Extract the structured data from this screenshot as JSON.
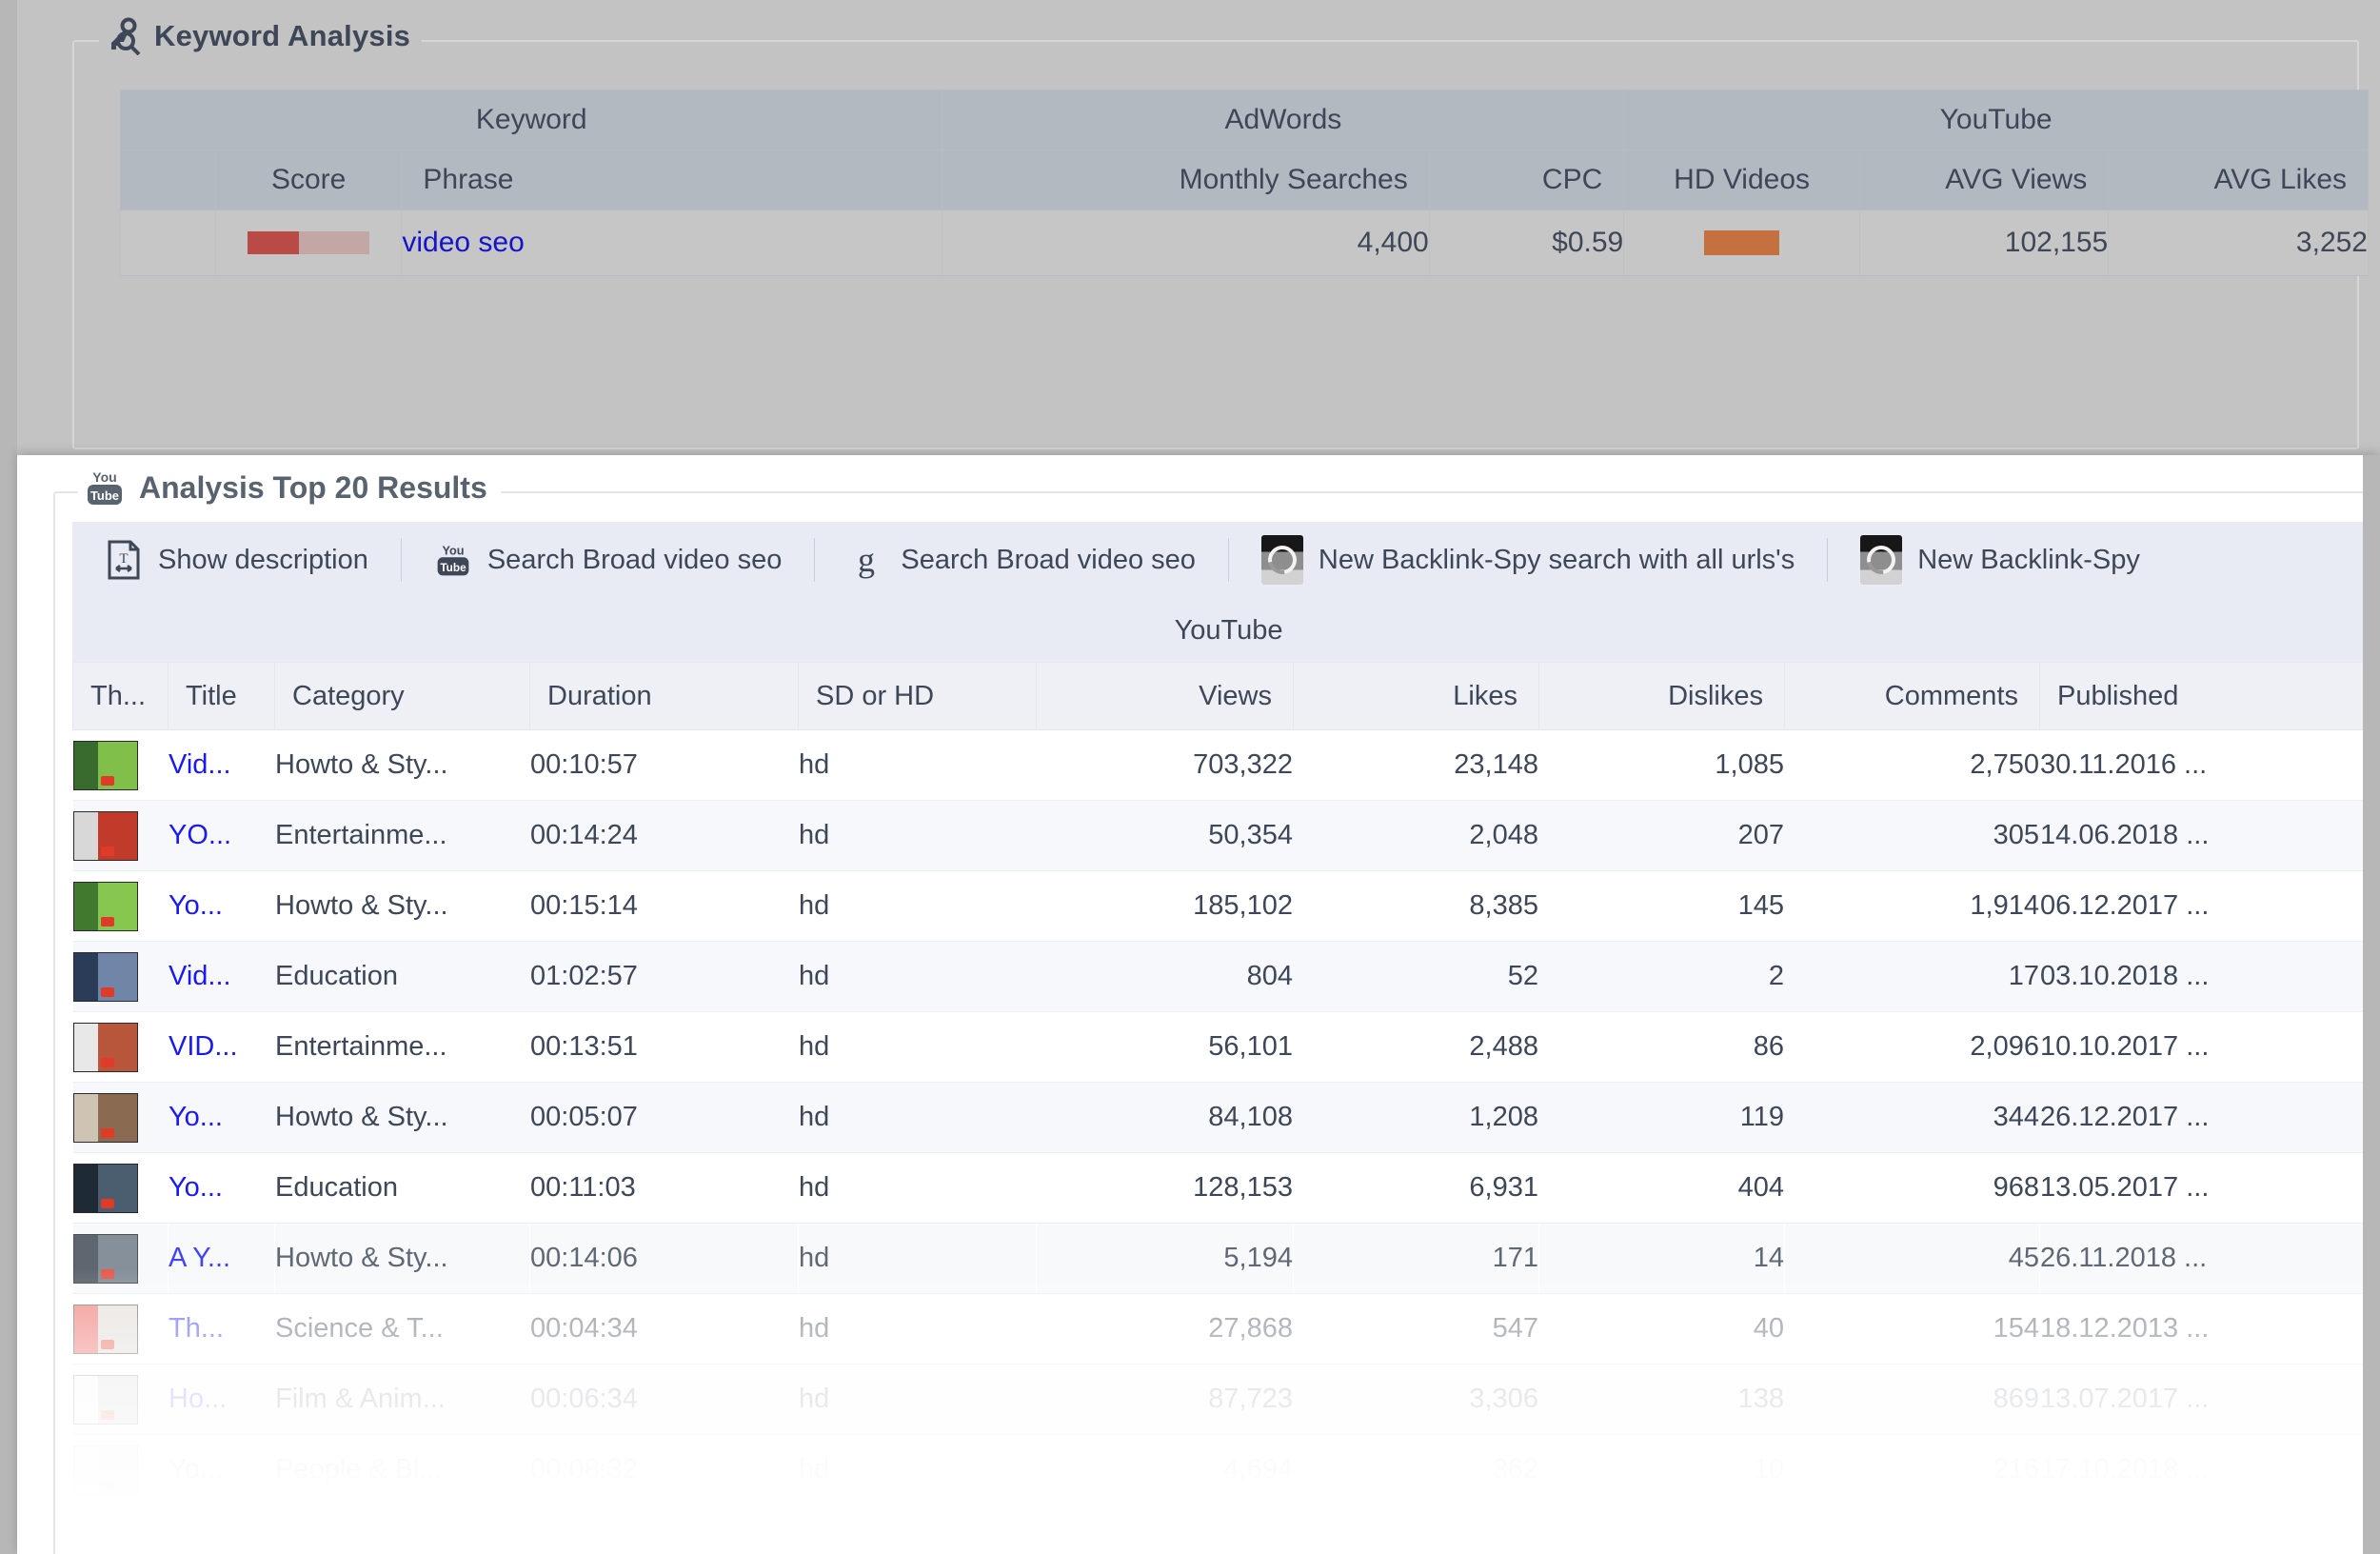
{
  "keyword_panel": {
    "title": "Keyword Analysis",
    "icon": "key-search-icon",
    "group_headers": {
      "keyword": "Keyword",
      "adwords": "AdWords",
      "youtube": "YouTube"
    },
    "columns": [
      "Score",
      "Phrase",
      "Monthly Searches",
      "CPC",
      "HD Videos",
      "AVG Views",
      "AVG Likes"
    ],
    "row": {
      "score_percent": 42,
      "score_fill_color": "#b94a45",
      "score_track_color": "#c3a7a4",
      "phrase": "video seo",
      "monthly_searches": "4,400",
      "cpc": "$0.59",
      "hd_videos_percent": 62,
      "hd_videos_color": "#c4713f",
      "avg_views": "102,155",
      "avg_likes": "3,252"
    }
  },
  "results_panel": {
    "title": "Analysis Top 20 Results",
    "icon": "youtube-logo-icon",
    "toolbar": [
      {
        "icon": "document-text-icon",
        "label": "Show description"
      },
      {
        "icon": "youtube-logo-icon",
        "label": "Search Broad video seo"
      },
      {
        "icon": "google-g-icon",
        "label": "Search Broad video seo"
      },
      {
        "icon": "backlink-spy-icon",
        "label": "New Backlink-Spy search with all urls's"
      },
      {
        "icon": "backlink-spy-icon",
        "label": "New Backlink-Spy"
      }
    ],
    "band_header": "YouTube",
    "columns": [
      "Th...",
      "Title",
      "Category",
      "Duration",
      "SD or HD",
      "Views",
      "Likes",
      "Dislikes",
      "Comments",
      "Published"
    ],
    "rows": [
      {
        "title": "Vid...",
        "category": "Howto & Sty...",
        "duration": "00:10:57",
        "sdhd": "hd",
        "views": "703,322",
        "likes": "23,148",
        "dislikes": "1,085",
        "comments": "2,750",
        "published": "30.11.2016 ...",
        "thumb_left": "#3a6b2e",
        "thumb_right": "#7fbf4a"
      },
      {
        "title": "YO...",
        "category": "Entertainme...",
        "duration": "00:14:24",
        "sdhd": "hd",
        "views": "50,354",
        "likes": "2,048",
        "dislikes": "207",
        "comments": "305",
        "published": "14.06.2018 ...",
        "thumb_left": "#d8d8d8",
        "thumb_right": "#c23b2a"
      },
      {
        "title": "Yo...",
        "category": "Howto & Sty...",
        "duration": "00:15:14",
        "sdhd": "hd",
        "views": "185,102",
        "likes": "8,385",
        "dislikes": "145",
        "comments": "1,914",
        "published": "06.12.2017 ...",
        "thumb_left": "#3f7a2f",
        "thumb_right": "#86c84f"
      },
      {
        "title": "Vid...",
        "category": "Education",
        "duration": "01:02:57",
        "sdhd": "hd",
        "views": "804",
        "likes": "52",
        "dislikes": "2",
        "comments": "17",
        "published": "03.10.2018 ...",
        "thumb_left": "#2b3c58",
        "thumb_right": "#6f86a8"
      },
      {
        "title": "VID...",
        "category": "Entertainme...",
        "duration": "00:13:51",
        "sdhd": "hd",
        "views": "56,101",
        "likes": "2,488",
        "dislikes": "86",
        "comments": "2,096",
        "published": "10.10.2017 ...",
        "thumb_left": "#e8e8e8",
        "thumb_right": "#b8563c"
      },
      {
        "title": "Yo...",
        "category": "Howto & Sty...",
        "duration": "00:05:07",
        "sdhd": "hd",
        "views": "84,108",
        "likes": "1,208",
        "dislikes": "119",
        "comments": "344",
        "published": "26.12.2017 ...",
        "thumb_left": "#cfc4b4",
        "thumb_right": "#8a6a50"
      },
      {
        "title": "Yo...",
        "category": "Education",
        "duration": "00:11:03",
        "sdhd": "hd",
        "views": "128,153",
        "likes": "6,931",
        "dislikes": "404",
        "comments": "968",
        "published": "13.05.2017 ...",
        "thumb_left": "#1e2a36",
        "thumb_right": "#4b5e70"
      },
      {
        "title": "A Y...",
        "category": "Howto & Sty...",
        "duration": "00:14:06",
        "sdhd": "hd",
        "views": "5,194",
        "likes": "171",
        "dislikes": "14",
        "comments": "45",
        "published": "26.11.2018 ...",
        "thumb_left": "#3b4650",
        "thumb_right": "#6b7885"
      },
      {
        "title": "Th...",
        "category": "Science & T...",
        "duration": "00:04:34",
        "sdhd": "hd",
        "views": "27,868",
        "likes": "547",
        "dislikes": "40",
        "comments": "154",
        "published": "18.12.2013 ...",
        "thumb_left": "#e8493f",
        "thumb_right": "#d8d2cc"
      },
      {
        "title": "Ho...",
        "category": "Film & Anim...",
        "duration": "00:06:34",
        "sdhd": "hd",
        "views": "87,723",
        "likes": "3,306",
        "dislikes": "138",
        "comments": "869",
        "published": "13.07.2017 ...",
        "thumb_left": "#f2f2f2",
        "thumb_right": "#b9bcc0"
      },
      {
        "title": "Yo...",
        "category": "People & Bl...",
        "duration": "00:08:32",
        "sdhd": "hd",
        "views": "4,694",
        "likes": "362",
        "dislikes": "10",
        "comments": "216",
        "published": "17.10.2018 ...",
        "thumb_left": "#efe6e2",
        "thumb_right": "#cdb9b1"
      }
    ]
  }
}
